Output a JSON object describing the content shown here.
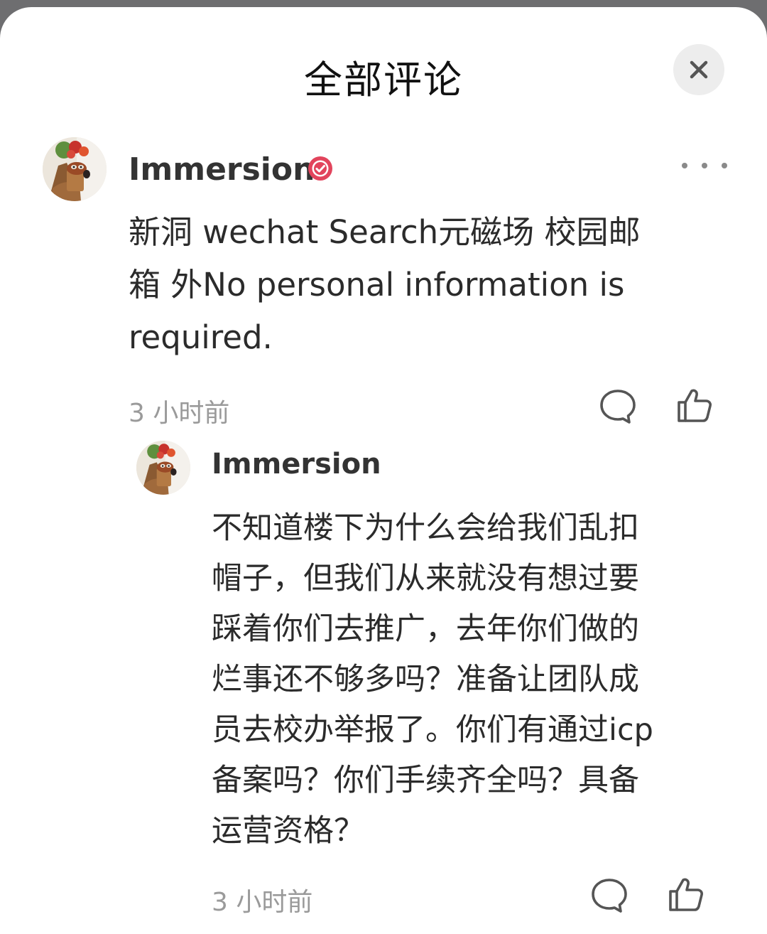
{
  "sheet": {
    "title": "全部评论"
  },
  "comments": [
    {
      "author": "Immersion",
      "verified": true,
      "text": "新洞 wechat Search元磁场 校园邮\n箱 外No personal information is\nrequired.",
      "time": "3 小时前"
    }
  ],
  "replies": [
    {
      "author": "Immersion",
      "text": "不知道楼下为什么会给我们乱扣\n帽子，但我们从来就没有想过要\n踩着你们去推广，去年你们做的\n烂事还不够多吗？准备让团队成\n员去校办举报了。你们有通过icp\n备案吗？你们手续齐全吗？具备\n运营资格？",
      "time": "3 小时前"
    }
  ],
  "icons": {
    "close": "close-icon",
    "more": "more-icon",
    "verified": "verified-badge-icon",
    "reply": "comment-bubble-icon",
    "like": "thumbs-up-icon"
  },
  "colors": {
    "verified_badge": "#e2445c",
    "timestamp": "#9a9a9a",
    "close_bg": "#ededed"
  }
}
